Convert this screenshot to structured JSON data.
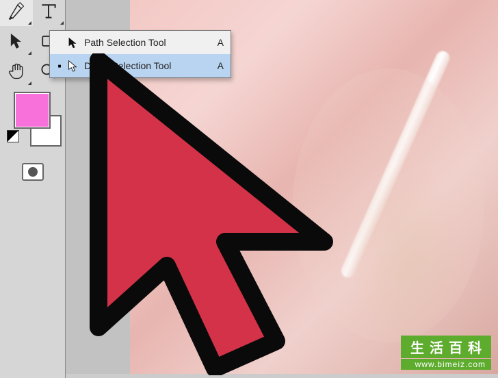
{
  "toolbox": {
    "rows": [
      {
        "left": "pen-tool",
        "right": "type-tool"
      },
      {
        "left": "path-selection-tool",
        "right": "shape-tool"
      },
      {
        "left": "hand-tool",
        "right": "zoom-tool"
      }
    ],
    "foreground_color": "#f871da",
    "background_color": "#ffffff",
    "quick_mask_label": "Quick Mask"
  },
  "flyout": {
    "items": [
      {
        "icon": "black-arrow",
        "label": "Path Selection Tool",
        "shortcut": "A",
        "selected": false
      },
      {
        "icon": "white-arrow",
        "label": "Direct Selection Tool",
        "shortcut": "A",
        "selected": true
      }
    ]
  },
  "watermark": {
    "title": "生活百科",
    "url": "www.bimeiz.com"
  }
}
